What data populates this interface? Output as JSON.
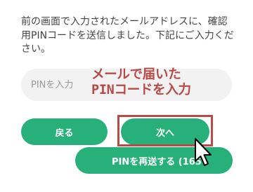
{
  "form": {
    "message": "前の画面で入力されたメールアドレスに、確認用PINコードを送信しました。下記にご入力ください。",
    "pin_placeholder": "PINを入力",
    "pin_value": ""
  },
  "buttons": {
    "back_label": "戻る",
    "next_label": "次へ",
    "resend_label": "PINを再送する (165"
  },
  "annotation": {
    "line1": "メールで届いた",
    "line2": "PINコードを入力",
    "color": "#b84a48"
  },
  "colors": {
    "button_green": "#28b07a",
    "input_bg": "#f2f2f2",
    "text": "#444444"
  },
  "icons": {
    "cursor": "arrow-pointer-icon"
  }
}
